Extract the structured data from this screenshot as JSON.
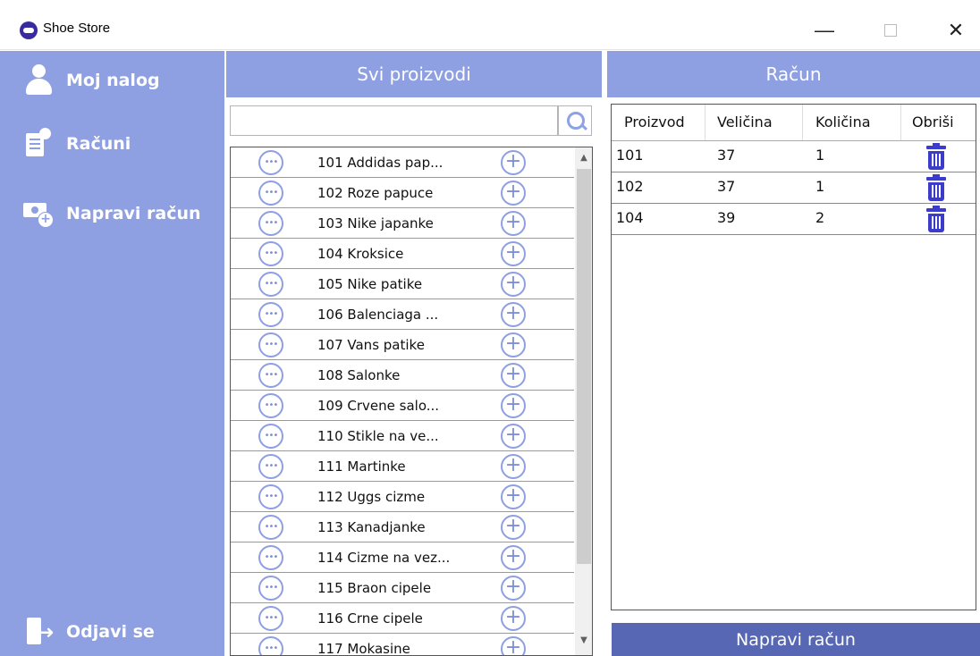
{
  "window": {
    "title": "Shoe Store"
  },
  "window_controls": {
    "minimize": "—",
    "close": "✕"
  },
  "sidebar": {
    "items": [
      {
        "label": "Moj nalog",
        "icon": "user-icon"
      },
      {
        "label": "Računi",
        "icon": "bills-icon"
      },
      {
        "label": "Napravi račun",
        "icon": "new-bill-icon"
      }
    ],
    "logout": {
      "label": "Odjavi se",
      "icon": "logout-icon"
    }
  },
  "products_panel": {
    "header": "Svi proizvodi",
    "search": {
      "value": "",
      "placeholder": ""
    },
    "items": [
      "101 Addidas pap...",
      "102 Roze papuce",
      "103 Nike japanke",
      "104 Kroksice",
      "105 Nike patike",
      "106 Balenciaga ...",
      "107 Vans patike",
      "108 Salonke",
      "109 Crvene salo...",
      "110 Stikle na ve...",
      "111 Martinke",
      "112 Uggs cizme",
      "113 Kanadjanke",
      "114 Cizme na vez...",
      "115 Braon cipele",
      "116 Crne cipele",
      "117 Mokasine"
    ]
  },
  "bill_panel": {
    "header": "Račun",
    "columns": [
      "Proizvod",
      "Veličina",
      "Količina",
      "Obriši"
    ],
    "rows": [
      {
        "product": "101",
        "size": "37",
        "quantity": "1"
      },
      {
        "product": "102",
        "size": "37",
        "quantity": "1"
      },
      {
        "product": "104",
        "size": "39",
        "quantity": "2"
      }
    ],
    "action_label": "Napravi račun"
  },
  "colors": {
    "sidebar": "#8e9fe2",
    "header": "#8e9fe2",
    "primary_button": "#5767b3",
    "trash": "#3b3bcc"
  }
}
